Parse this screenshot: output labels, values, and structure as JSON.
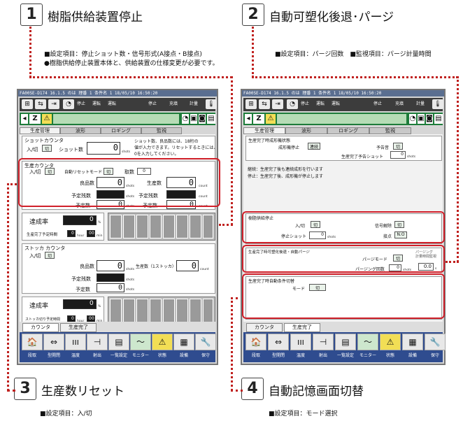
{
  "sections": [
    {
      "num": "1",
      "title": "樹脂供給装置停止"
    },
    {
      "num": "2",
      "title": "自動可塑化後退･パージ"
    },
    {
      "num": "3",
      "title": "生産数リセット"
    },
    {
      "num": "4",
      "title": "自動記憶画面切替"
    }
  ],
  "notes": {
    "n1a": "■設定項目：停止ショット数・信号形式(A接点・B接点)",
    "n1b": "●樹脂供給停止装置本体と、供給装置の仕様変更が必要です。",
    "n2": "■設定項目：パージ回数　■監視項目：パージ計量時間",
    "n3": "■設定項目：入/切",
    "n4": "■設定項目：モード選択"
  },
  "screen_common": {
    "title_bar": "FA00SE-D174  16.1.5    のは 理番 1    条件名 1                       18/05/10  16:50:20",
    "tab_labels": [
      "生産管理",
      "波形",
      "ロギング",
      "監視"
    ],
    "nav_labels": [
      "段取",
      "型開閉",
      "温度",
      "射出",
      "一覧設定",
      "モニター",
      "状態",
      "設備",
      "保守"
    ],
    "nav_icons": [
      "🏠",
      "⇔",
      "ııı",
      "⊣",
      "▤",
      "〜",
      "⚠",
      "▦",
      "🔧"
    ],
    "toolbar_labels": [
      "停止",
      "運転",
      "運転"
    ],
    "toolbar_right": [
      "停止",
      "充填",
      "計量"
    ],
    "z_label": "Z",
    "warn_icon": "⚠"
  },
  "left_screen": {
    "shot_counter": {
      "title": "ショットカウンタ",
      "onoff_label": "入/切",
      "onoff_value": "切",
      "shot_count_label": "ショット数",
      "shot_count_value": "0",
      "unit": "shots",
      "note_l1": "ショット数、良品数には、18桁の",
      "note_l2": "値が入力できます。リセットするときには、",
      "note_l3": "0を入力してください。"
    },
    "prod_counter": {
      "title": "生産カウンタ",
      "onoff_label": "入/切",
      "onoff_value": "切",
      "auto_reset_label": "自動リセットモード",
      "auto_reset_value": "切",
      "pcs_label": "取数",
      "pcs_value": "0",
      "good_label": "良品数",
      "good_value": "0",
      "prod_label": "生産数",
      "prod_value": "0",
      "remain_label_l": "予定残数",
      "remain_label_r": "予定残数",
      "plan_label_l": "予定数",
      "plan_label_r": "予定数",
      "plan_value_l": "0",
      "plan_value_r": "0",
      "unit_shots": "shots",
      "unit_count": "count"
    },
    "rate": {
      "label": "達成率",
      "value": "0",
      "unit": "%",
      "time_label": "生産完了予定時間",
      "hour_value": "0",
      "min_value": "00",
      "hour_unit": "hour",
      "min_unit": "min"
    },
    "stock_counter": {
      "title": "ストッカ カウンタ",
      "onoff_label": "入/切",
      "onoff_value": "切",
      "good_label": "良品数",
      "good_value": "0",
      "prod_label": "生産数（1ストッカ）",
      "prod_value": "0",
      "remain_label": "予定残数",
      "plan_label": "予定数",
      "plan_value": "0",
      "unit_shots": "shots",
      "unit_count": "count"
    },
    "rate2": {
      "label": "達成率",
      "value": "0",
      "unit": "%",
      "time_label": "ストッカ切り予定時間",
      "hour_value": "0",
      "min_value": "00",
      "hour_unit": "hour",
      "min_unit": "min"
    },
    "bottom_tabs": [
      "カウンタ",
      "生産完了"
    ]
  },
  "right_screen": {
    "complete": {
      "title": "生産完了時成形機状態",
      "stop_label": "成形機停止",
      "stop_value": "連続",
      "buzzer_label": "予告音",
      "buzzer_value": "切",
      "notice_label": "生産完了予告ショット",
      "notice_value": "0",
      "unit": "shots"
    },
    "msg1": "継続：生産完了後も連続成形を行います",
    "msg2": "停止：生産完了後、成形機が停止します",
    "resin": {
      "title": "樹脂供給停止",
      "onoff_label": "入/切",
      "onoff_value": "切",
      "signal_label": "信号解除",
      "signal_value": "切",
      "stop_shot_label": "停止ショット",
      "stop_shot_value": "0",
      "unit": "shots",
      "contact_label": "接点",
      "contact_value": "N.O"
    },
    "purge": {
      "title": "生産完了時可塑化後退・自動パージ",
      "mode_label": "パージモード",
      "mode_value": "切",
      "count_label": "パージング回数",
      "count_value": "0",
      "count_unit": "shots",
      "time_label": "パージング\n計量時間監視",
      "time_value": "0.0",
      "time_unit": "s"
    },
    "memory": {
      "title": "生産完了時自動条件切替",
      "mode_label": "モード",
      "mode_value": "切"
    },
    "bottom_tabs": [
      "カウンタ",
      "生産完了"
    ]
  }
}
